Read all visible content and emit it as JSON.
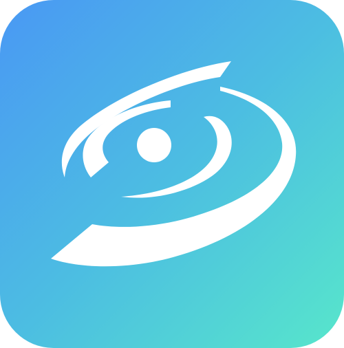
{
  "icon": {
    "name": "app-logo-swirl-eye",
    "gradient_start": "#4a98f4",
    "gradient_mid": "#4cbde2",
    "gradient_end": "#57e6cb",
    "glyph_color": "#ffffff"
  }
}
